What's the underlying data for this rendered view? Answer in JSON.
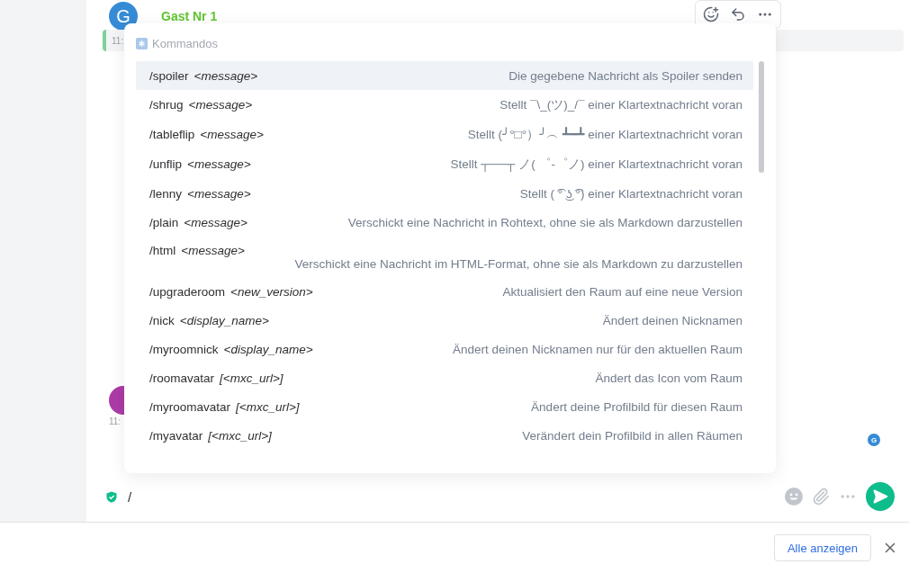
{
  "message": {
    "avatar": "G",
    "sender": "Gast Nr 1",
    "timestamp": "11:"
  },
  "second_message": {
    "timestamp": "11:"
  },
  "read_receipt": "G",
  "autocomplete": {
    "title": "Kommandos",
    "commands": [
      {
        "command": "/spoiler",
        "args": "<message>",
        "description": "Die gegebene Nachricht als Spoiler senden",
        "selected": true
      },
      {
        "command": "/shrug",
        "args": "<message>",
        "description": "Stellt ¯\\_(ツ)_/¯ einer Klartextnachricht voran",
        "selected": false
      },
      {
        "command": "/tableflip",
        "args": "<message>",
        "description": "Stellt (╯°□°）╯︵ ┻━┻ einer Klartextnachricht voran",
        "selected": false
      },
      {
        "command": "/unflip",
        "args": "<message>",
        "description": "Stellt ┬──┬ ノ( ゜-゜ノ) einer Klartextnachricht voran",
        "selected": false
      },
      {
        "command": "/lenny",
        "args": "<message>",
        "description": "Stellt ( ͡° ͜ʖ ͡°) einer Klartextnachricht voran",
        "selected": false
      },
      {
        "command": "/plain",
        "args": "<message>",
        "description": "Verschickt eine Nachricht in Rohtext, ohne sie als Markdown darzustellen",
        "selected": false
      },
      {
        "command": "/html",
        "args": "<message>",
        "description": "Verschickt eine Nachricht im HTML-Format, ohne sie als Markdown zu darzustellen",
        "selected": false
      },
      {
        "command": "/upgraderoom",
        "args": "<new_version>",
        "description": "Aktualisiert den Raum auf eine neue Version",
        "selected": false
      },
      {
        "command": "/nick",
        "args": "<display_name>",
        "description": "Ändert deinen Nicknamen",
        "selected": false
      },
      {
        "command": "/myroomnick",
        "args": "<display_name>",
        "description": "Ändert deinen Nicknamen nur für den aktuellen Raum",
        "selected": false
      },
      {
        "command": "/roomavatar",
        "args": "[<mxc_url>]",
        "description": "Ändert das Icon vom Raum",
        "selected": false
      },
      {
        "command": "/myroomavatar",
        "args": "[<mxc_url>]",
        "description": "Ändert deine Profilbild für diesen Raum",
        "selected": false
      },
      {
        "command": "/myavatar",
        "args": "[<mxc_url>]",
        "description": "Verändert dein Profilbild in allen Räumen",
        "selected": false
      }
    ]
  },
  "composer": {
    "value": "/"
  },
  "footer": {
    "button": "Alle anzeigen"
  }
}
